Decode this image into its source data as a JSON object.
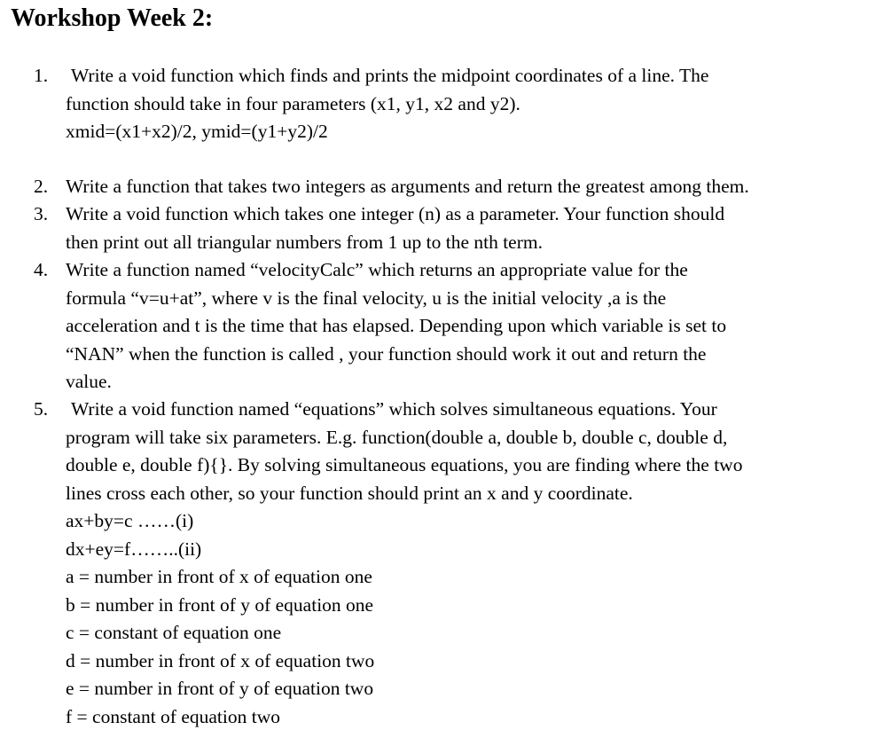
{
  "title": "Workshop Week 2:",
  "items": [
    {
      "number": "1.",
      "lines": [
        "Write a void function which finds and prints the midpoint coordinates of a line. The",
        "function should take in four parameters (x1, y1, x2 and y2).",
        "xmid=(x1+x2)/2, ymid=(y1+y2)/2"
      ]
    },
    {
      "number": "2.",
      "lines": [
        "Write a function that takes two integers as arguments and return the greatest among them."
      ]
    },
    {
      "number": "3.",
      "lines": [
        "Write a void function which takes one integer (n) as a parameter. Your function should",
        "then print out all triangular numbers from 1 up to the nth term."
      ]
    },
    {
      "number": "4.",
      "lines": [
        "Write a function named “velocityCalc” which returns an appropriate value for the",
        "formula “v=u+at”, where v is the final velocity, u is the initial velocity ,a is the",
        "acceleration and t is the time that has elapsed. Depending upon which variable is set to",
        "“NAN” when the function is called , your function should work it out and return the",
        "value."
      ]
    },
    {
      "number": "5.",
      "lines": [
        "Write a void function named “equations” which solves simultaneous equations. Your",
        "program will take six parameters. E.g. function(double a, double b, double c, double d,",
        "double e, double f){}. By solving simultaneous equations, you are finding where the two",
        "lines cross each other, so your function should print an x and y coordinate.",
        "ax+by=c ……(i)",
        "dx+ey=f……..(ii)",
        "a = number in front of x of equation one",
        "b = number in front of y of equation one",
        "c = constant of equation one",
        "d = number in front of x of equation two",
        "e = number in front of y of equation two",
        "f = constant of equation two"
      ]
    }
  ]
}
